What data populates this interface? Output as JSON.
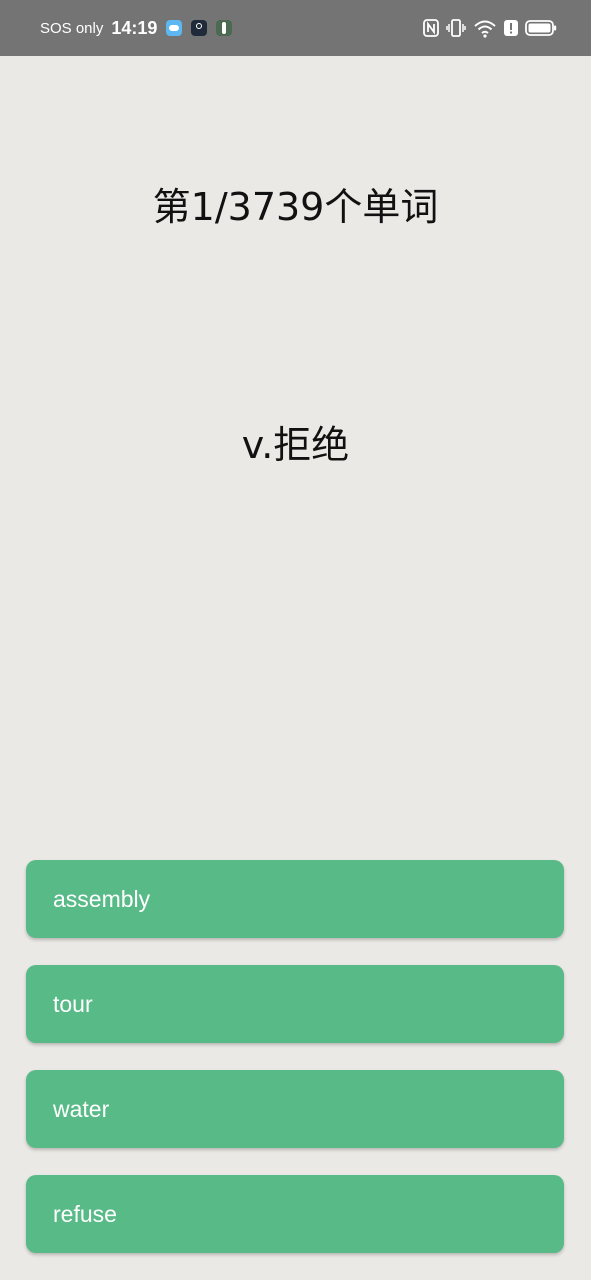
{
  "status_bar": {
    "carrier": "SOS only",
    "time": "14:19",
    "notification_icons": [
      "weather-app-icon",
      "location-app-icon",
      "person-app-icon"
    ],
    "system_icons": [
      "nfc-icon",
      "vibrate-icon",
      "wifi-6-icon",
      "alert-icon",
      "battery-icon"
    ]
  },
  "quiz": {
    "progress": "第1/3739个单词",
    "definition": "v.拒绝",
    "options": [
      "assembly",
      "tour",
      "water",
      "refuse"
    ]
  },
  "colors": {
    "background": "#EBE9E6",
    "status_bar": "#747474",
    "option_button": "#58BA87",
    "option_text": "#FFFFFF"
  }
}
